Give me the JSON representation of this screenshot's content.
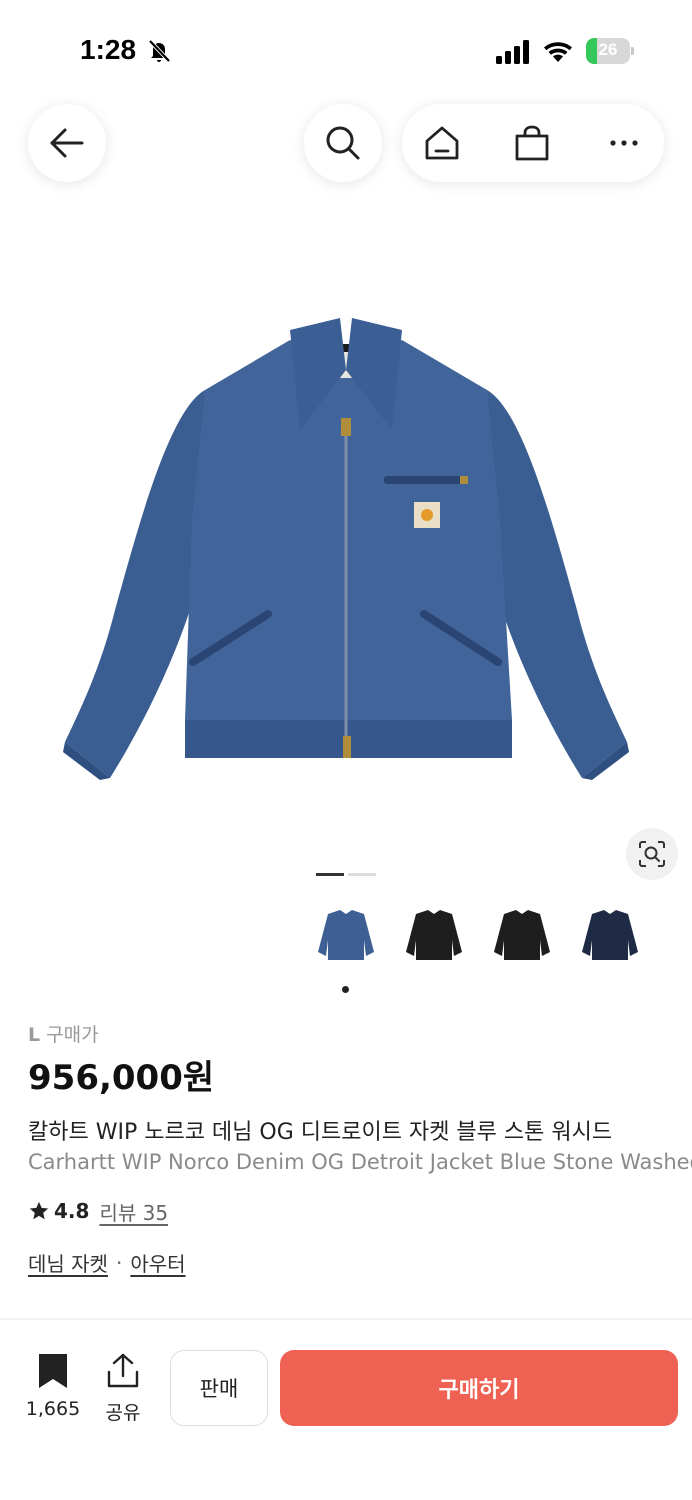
{
  "status_bar": {
    "time": "1:28",
    "battery": "26",
    "battery_level": 0.26
  },
  "nav": {
    "back_icon": "arrow-left-icon",
    "search_icon": "search-icon",
    "home_icon": "home-icon",
    "bag_icon": "shopping-bag-icon",
    "more_icon": "more-dots-icon"
  },
  "gallery": {
    "current_page": 1,
    "total_pages": 2,
    "thumbnail_colors": [
      "#3d5f93",
      "#1e1e1e",
      "#1e1e1e",
      "#1f2a45"
    ],
    "selected_thumbnail": 1
  },
  "product": {
    "size_prefix": "L",
    "size_label": "구매가",
    "price": "956,000원",
    "name_ko": "칼하트 WIP 노르코 데님 OG 디트로이트 자켓 블루 스톤 워시드",
    "name_en": "Carhartt WIP Norco Denim OG Detroit Jacket Blue Stone Washed",
    "rating": "4.8",
    "review_label": "리뷰 35",
    "categories": [
      "데님 자켓",
      "아우터"
    ],
    "category_separator": "·"
  },
  "bottom_bar": {
    "bookmark_count": "1,665",
    "share_label": "공유",
    "sell_label": "판매",
    "buy_label": "구매하기"
  },
  "colors": {
    "accent": "#ef6253",
    "denim": "#3d5f93"
  }
}
